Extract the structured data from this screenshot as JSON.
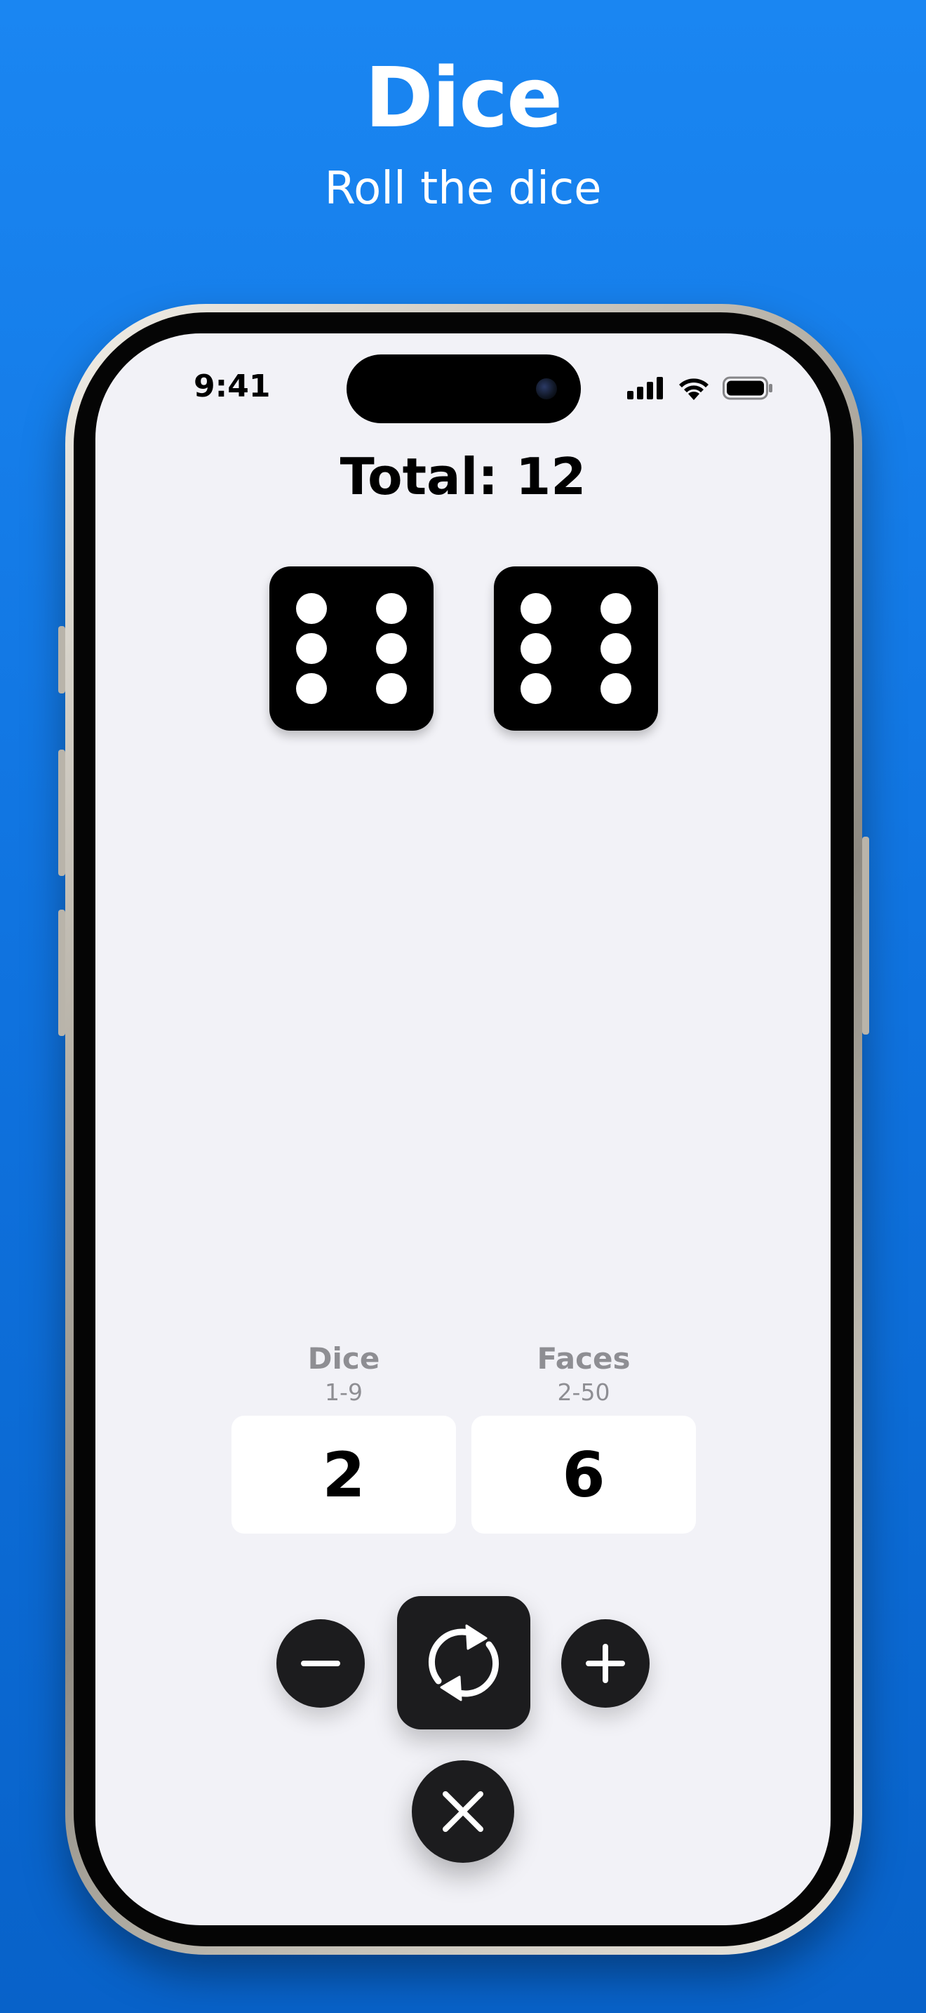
{
  "promo": {
    "title": "Dice",
    "subtitle": "Roll the dice"
  },
  "status_bar": {
    "time": "9:41",
    "icons": [
      "cellular-signal-icon",
      "wifi-icon",
      "battery-icon"
    ]
  },
  "app": {
    "total_label": "Total: 12",
    "dice": [
      {
        "face_value": 6
      },
      {
        "face_value": 6
      }
    ],
    "settings": {
      "dice": {
        "label": "Dice",
        "range": "1-9",
        "value": "2"
      },
      "faces": {
        "label": "Faces",
        "range": "2-50",
        "value": "6"
      }
    },
    "controls": {
      "decrement": "minus-icon",
      "roll": "refresh-icon",
      "increment": "plus-icon",
      "close": "close-icon"
    }
  },
  "colors": {
    "background_top": "#1a86f2",
    "background_bottom": "#0862c9",
    "screen_background": "#f2f2f7",
    "button_dark": "#1c1c1e",
    "secondary_text": "#8e8e93"
  }
}
